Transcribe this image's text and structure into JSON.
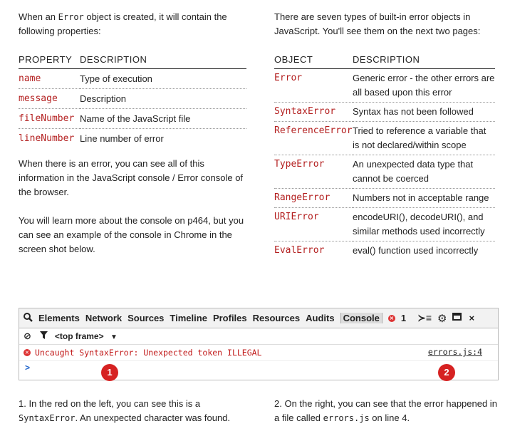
{
  "left": {
    "intro_pre": "When an ",
    "intro_code": "Error",
    "intro_post": " object is created, it will contain the following properties:",
    "table_headers": [
      "PROPERTY",
      "DESCRIPTION"
    ],
    "properties": [
      {
        "name": "name",
        "description": "Type of execution"
      },
      {
        "name": "message",
        "description": "Description"
      },
      {
        "name": "fileNumber",
        "description": "Name of the JavaScript file"
      },
      {
        "name": "lineNumber",
        "description": "Line number of error"
      }
    ],
    "para1": "When there is an error, you can see all of this information in the JavaScript console / Error console of the browser.",
    "para2": "You will learn more about the console on p464, but you can see an example of the console in Chrome in the screen shot below."
  },
  "right": {
    "intro": "There are seven types of built-in error objects in JavaScript. You'll see them on the next two pages:",
    "table_headers": [
      "OBJECT",
      "DESCRIPTION"
    ],
    "objects": [
      {
        "name": "Error",
        "description": "Generic error - the other errors are all based upon this error"
      },
      {
        "name": "SyntaxError",
        "description": "Syntax has not been followed"
      },
      {
        "name": "ReferenceError",
        "description": "Tried to reference a variable that is not declared/within scope"
      },
      {
        "name": "TypeError",
        "description": "An unexpected data type that cannot be coerced"
      },
      {
        "name": "RangeError",
        "description": "Numbers not in acceptable range"
      },
      {
        "name": "URIError",
        "description": "encodeURI(), decodeURI(), and similar methods used incorrectly"
      },
      {
        "name": "EvalError",
        "description": "eval() function used incorrectly"
      }
    ]
  },
  "console": {
    "tabs": [
      "Elements",
      "Network",
      "Sources",
      "Timeline",
      "Profiles",
      "Resources",
      "Audits",
      "Console"
    ],
    "error_count": "1",
    "frame": "<top frame>",
    "error_message": "Uncaught SyntaxError: Unexpected token ILLEGAL",
    "error_file": "errors.js:4",
    "prompt": ">",
    "icons": [
      "search-icon",
      "clear-icon",
      "filter-icon",
      "error-count-icon",
      "drawer-icon",
      "settings-icon",
      "dock-icon",
      "close-icon"
    ]
  },
  "markers": [
    "1",
    "2"
  ],
  "captions": {
    "one_pre": "1. In the red on the left, you can see this is a ",
    "one_code": "SyntaxError",
    "one_post": ". An unexpected character was found.",
    "two_pre": "2. On the right, you can see that the error happened in a file called ",
    "two_code": "errors.js",
    "two_post": " on line 4."
  }
}
